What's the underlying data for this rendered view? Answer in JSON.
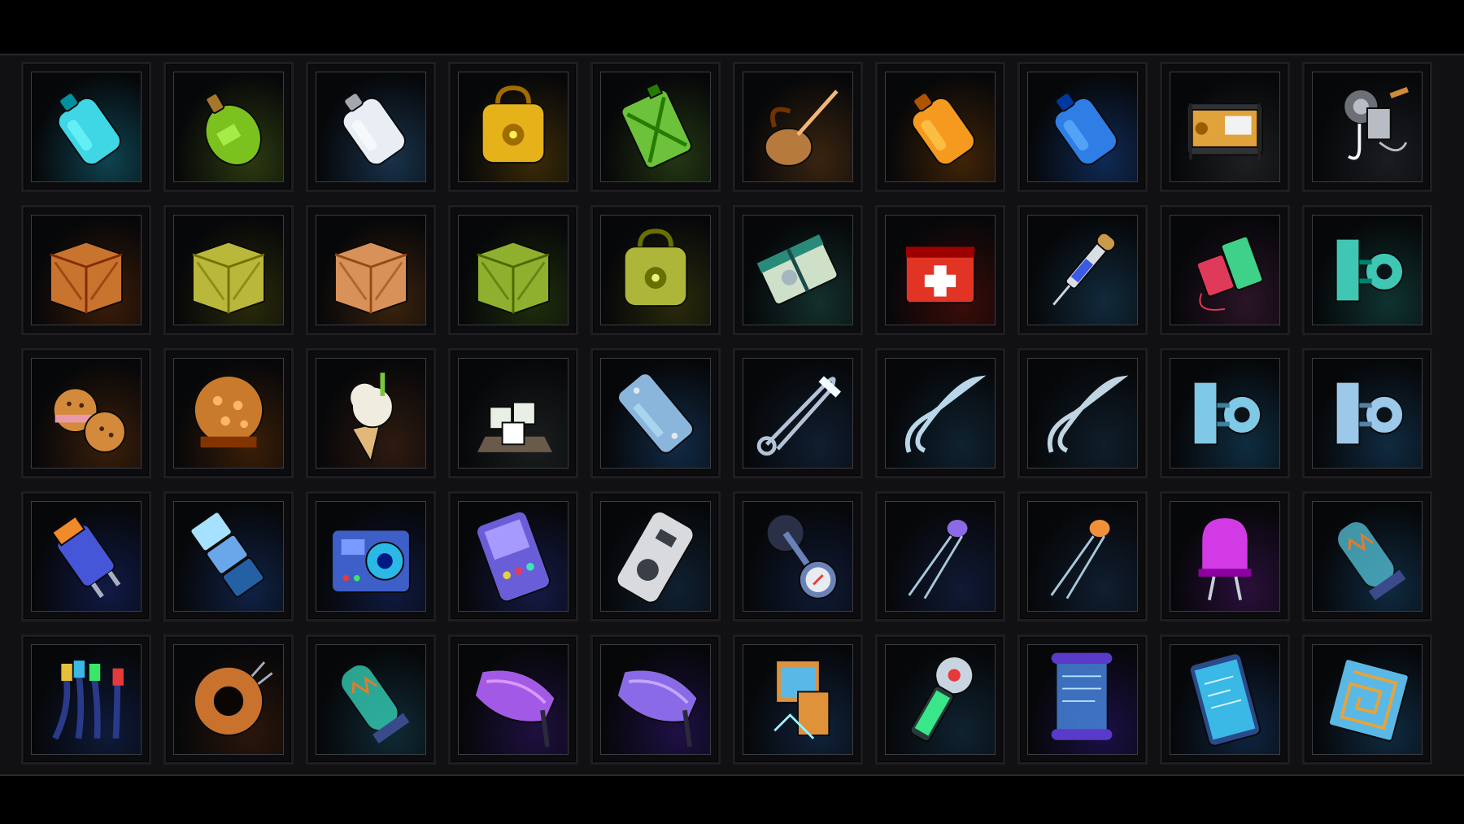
{
  "inventory": {
    "rows": 5,
    "columns": 10,
    "items": [
      {
        "name": "glass-water-jug-icon",
        "color": "#3fd6e6",
        "bg": "#0e4350",
        "shape": "jug"
      },
      {
        "name": "green-canteen-icon",
        "color": "#7cc21f",
        "bg": "#2c3a10",
        "shape": "flask"
      },
      {
        "name": "plastic-milk-jug-icon",
        "color": "#e8eef4",
        "bg": "#18324a",
        "shape": "jug"
      },
      {
        "name": "radioactive-container-icon",
        "color": "#e5b21a",
        "bg": "#3a2a08",
        "shape": "box-round"
      },
      {
        "name": "green-jerrycan-icon",
        "color": "#6cc23a",
        "bg": "#233612",
        "shape": "can"
      },
      {
        "name": "oil-can-icon",
        "color": "#b57a3c",
        "bg": "#3a2410",
        "shape": "oilcan"
      },
      {
        "name": "orange-jug-icon",
        "color": "#f59a1e",
        "bg": "#3f2308",
        "shape": "jug"
      },
      {
        "name": "blue-water-bottle-icon",
        "color": "#2e7ee6",
        "bg": "#0f2a55",
        "shape": "jug"
      },
      {
        "name": "generator-icon",
        "color": "#e0a23a",
        "bg": "#1e1f22",
        "shape": "generator"
      },
      {
        "name": "winch-hook-icon",
        "color": "#b8bcc4",
        "bg": "#1a1c20",
        "shape": "winch"
      },
      {
        "name": "wooden-crate-icon",
        "color": "#c8732e",
        "bg": "#3a1c08",
        "shape": "crate"
      },
      {
        "name": "military-crate-icon",
        "color": "#b9b83a",
        "bg": "#2a2a0a",
        "shape": "crate"
      },
      {
        "name": "cardboard-box-icon",
        "color": "#d9915a",
        "bg": "#3a220e",
        "shape": "crate"
      },
      {
        "name": "ammo-box-icon",
        "color": "#8fb02e",
        "bg": "#1f2d0c",
        "shape": "crate"
      },
      {
        "name": "mess-tin-icon",
        "color": "#aeb63a",
        "bg": "#2a2a0c",
        "shape": "box-round"
      },
      {
        "name": "cash-bundle-icon",
        "color": "#cfe0c8",
        "bg": "#13302c",
        "shape": "bundle"
      },
      {
        "name": "first-aid-kit-icon",
        "color": "#e23424",
        "bg": "#3a0c08",
        "shape": "medkit"
      },
      {
        "name": "syringe-icon",
        "color": "#d8dde6",
        "bg": "#112a3c",
        "shape": "syringe"
      },
      {
        "name": "thread-spools-icon",
        "color": "#3fd08a",
        "bg": "#2a1426",
        "shape": "spools"
      },
      {
        "name": "metal-bracket-icon",
        "color": "#3fc7b4",
        "bg": "#0f3330",
        "shape": "bracket"
      },
      {
        "name": "cookies-icon",
        "color": "#d38a3a",
        "bg": "#3a1e0a",
        "shape": "cookies"
      },
      {
        "name": "muffin-icon",
        "color": "#c97a2a",
        "bg": "#3a1e08",
        "shape": "muffin"
      },
      {
        "name": "ice-cream-cone-icon",
        "color": "#f1ece0",
        "bg": "#2e1a10",
        "shape": "cone"
      },
      {
        "name": "sugar-cubes-icon",
        "color": "#e8efe4",
        "bg": "#1a1e1e",
        "shape": "cubes"
      },
      {
        "name": "metal-plate-icon",
        "color": "#8ab6dc",
        "bg": "#112a45",
        "shape": "plate"
      },
      {
        "name": "safety-pin-icon",
        "color": "#b4c4d8",
        "bg": "#101e30",
        "shape": "pin"
      },
      {
        "name": "bent-wire-icon",
        "color": "#b8d8ea",
        "bg": "#0f2230",
        "shape": "wire"
      },
      {
        "name": "paper-clip-icon",
        "color": "#c0d4e2",
        "bg": "#0f1e2a",
        "shape": "wire"
      },
      {
        "name": "pipe-clamp-icon",
        "color": "#7fc8e6",
        "bg": "#0f2c40",
        "shape": "bracket"
      },
      {
        "name": "pipe-fitting-icon",
        "color": "#9cc8ea",
        "bg": "#102a40",
        "shape": "bracket"
      },
      {
        "name": "power-plug-icon",
        "color": "#4656d8",
        "bg": "#101a45",
        "shape": "plug"
      },
      {
        "name": "ice-bars-icon",
        "color": "#6aa6ea",
        "bg": "#0f2245",
        "shape": "bars"
      },
      {
        "name": "radio-receiver-icon",
        "color": "#3e5ec8",
        "bg": "#0f1a40",
        "shape": "radio"
      },
      {
        "name": "handheld-console-icon",
        "color": "#6a5ed8",
        "bg": "#151a45",
        "shape": "console"
      },
      {
        "name": "remote-control-icon",
        "color": "#d8dade",
        "bg": "#102030",
        "shape": "remote"
      },
      {
        "name": "compass-icon",
        "color": "#6a82b8",
        "bg": "#0f1a35",
        "shape": "compass"
      },
      {
        "name": "led-diodes-icon",
        "color": "#8a6ae6",
        "bg": "#101a35",
        "shape": "diode"
      },
      {
        "name": "ceramic-capacitor-icon",
        "color": "#f0903a",
        "bg": "#101e30",
        "shape": "diode"
      },
      {
        "name": "purple-led-icon",
        "color": "#d23ae6",
        "bg": "#2a0f3a",
        "shape": "led"
      },
      {
        "name": "vacuum-tube-icon",
        "color": "#5ad0e6",
        "bg": "#0f2a40",
        "shape": "tube"
      },
      {
        "name": "rca-cables-icon",
        "color": "#3aa0e6",
        "bg": "#0f1a3a",
        "shape": "cables"
      },
      {
        "name": "toroid-coil-icon",
        "color": "#c8722e",
        "bg": "#2a160a",
        "shape": "toroid"
      },
      {
        "name": "circuit-module-icon",
        "color": "#3ae6c8",
        "bg": "#0f2a35",
        "shape": "tube"
      },
      {
        "name": "vr-visor-icon",
        "color": "#a25ae6",
        "bg": "#1e1040",
        "shape": "visor"
      },
      {
        "name": "smart-glasses-icon",
        "color": "#8a6ae6",
        "bg": "#1e1045",
        "shape": "visor"
      },
      {
        "name": "computer-terminal-icon",
        "color": "#5ab8e6",
        "bg": "#10223a",
        "shape": "terminal"
      },
      {
        "name": "scanner-device-icon",
        "color": "#3ae68a",
        "bg": "#0f2230",
        "shape": "scanner"
      },
      {
        "name": "holo-display-icon",
        "color": "#4a8ae6",
        "bg": "#1a1045",
        "shape": "holo"
      },
      {
        "name": "tablet-device-icon",
        "color": "#3ab8e6",
        "bg": "#0f2440",
        "shape": "tablet"
      },
      {
        "name": "circuit-board-icon",
        "color": "#e6a43a",
        "bg": "#0f2a40",
        "shape": "chip"
      }
    ]
  }
}
